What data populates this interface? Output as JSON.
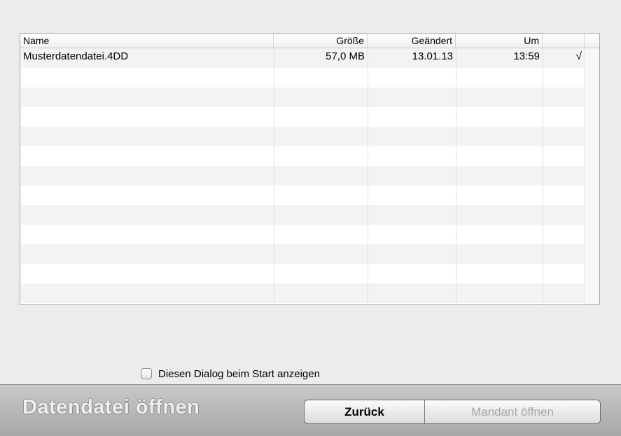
{
  "table": {
    "columns": {
      "name": "Name",
      "size": "Größe",
      "modified": "Geändert",
      "time": "Um",
      "flag": ""
    },
    "rows": [
      {
        "name": "Musterdatendatei.4DD",
        "size": "57,0 MB",
        "modified": "13.01.13",
        "time": "13:59",
        "flag": "√"
      }
    ]
  },
  "startup_option": {
    "label": "Diesen Dialog beim Start anzeigen",
    "checked": false
  },
  "footer": {
    "title": "Datendatei öffnen",
    "back_label": "Zurück",
    "open_label": "Mandant öffnen"
  }
}
